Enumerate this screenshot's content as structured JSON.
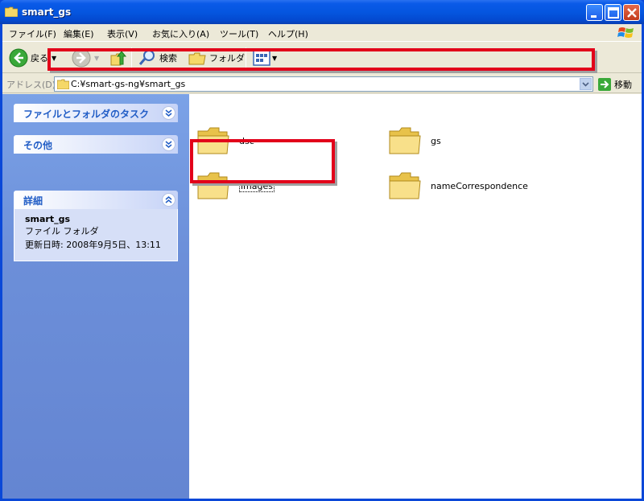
{
  "window": {
    "title": "smart_gs"
  },
  "menu": {
    "items": [
      {
        "label": "ファイル(F)"
      },
      {
        "label": "編集(E)"
      },
      {
        "label": "表示(V)"
      },
      {
        "label": "お気に入り(A)"
      },
      {
        "label": "ツール(T)"
      },
      {
        "label": "ヘルプ(H)"
      }
    ]
  },
  "toolbar": {
    "back_label": "戻る",
    "search_label": "検索",
    "folders_label": "フォルダ"
  },
  "address": {
    "label": "アドレス(D)",
    "value": "C:¥smart-gs-ng¥smart_gs",
    "go_label": "移動"
  },
  "taskpane": {
    "file_tasks_title": "ファイルとフォルダのタスク",
    "other_title": "その他",
    "details_title": "詳細",
    "details": {
      "name": "smart_gs",
      "type": "ファイル フォルダ",
      "modified": "更新日時: 2008年9月5日、13:11"
    }
  },
  "content": {
    "items": [
      {
        "name": "dsc"
      },
      {
        "name": "gs"
      },
      {
        "name": "images"
      },
      {
        "name": "nameCorrespondence"
      }
    ]
  },
  "colors": {
    "titlebar": "#0a5ae8",
    "highlight_box": "#e2001a",
    "taskpane_header_text": "#215dc6",
    "folder": "#f5d868"
  }
}
